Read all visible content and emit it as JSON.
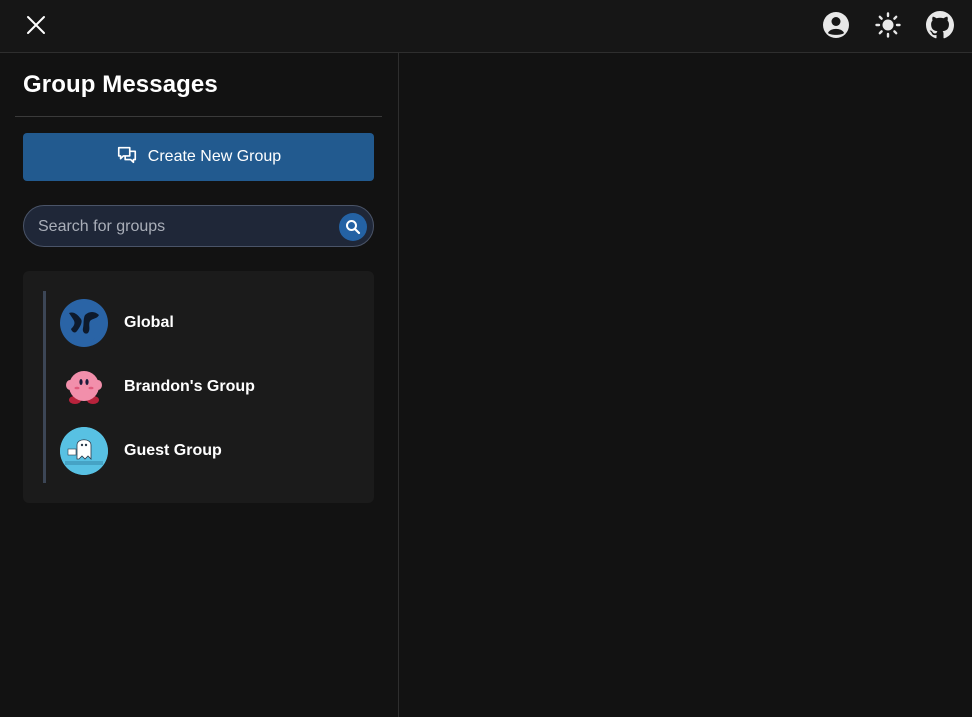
{
  "topbar": {
    "icons": [
      "close-icon",
      "account-icon",
      "sun-icon",
      "github-icon"
    ]
  },
  "sidebar": {
    "title": "Group Messages",
    "create_button": {
      "label": "Create New Group",
      "icon": "chat-bubbles-icon"
    },
    "search": {
      "placeholder": "Search for groups",
      "value": "",
      "icon": "search-icon"
    },
    "groups": [
      {
        "name": "Global",
        "avatar": "globe-avatar"
      },
      {
        "name": "Brandon's Group",
        "avatar": "kirby-avatar"
      },
      {
        "name": "Guest Group",
        "avatar": "ghost-avatar"
      }
    ]
  },
  "colors": {
    "background": "#121212",
    "accent": "#225a8f",
    "panel": "#1b1b1b",
    "search_bg": "#1f2738"
  }
}
